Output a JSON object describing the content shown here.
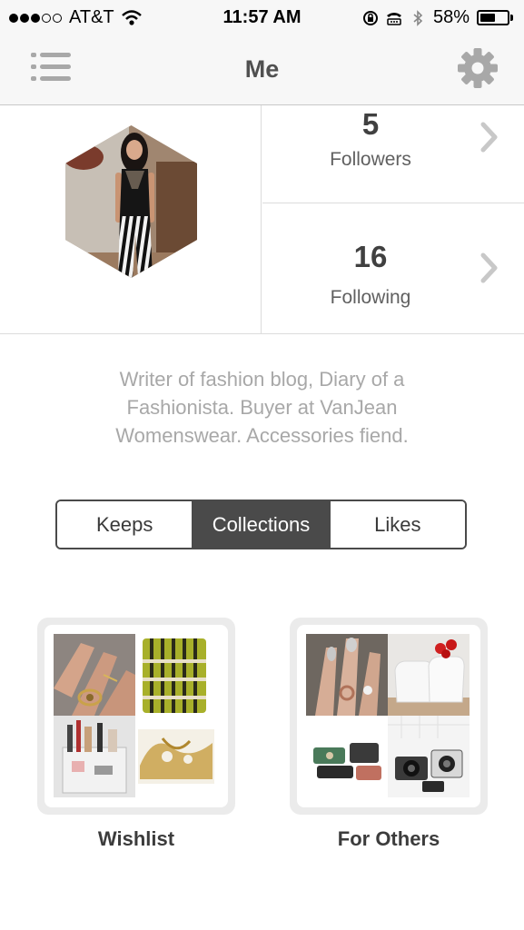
{
  "status_bar": {
    "carrier": "AT&T",
    "time": "11:57 AM",
    "battery": "58%",
    "battery_level": 0.58,
    "signal_bars": 3
  },
  "nav": {
    "title": "Me"
  },
  "profile": {
    "followers": {
      "count": "5",
      "label": "Followers"
    },
    "following": {
      "count": "16",
      "label": "Following"
    },
    "bio": "Writer of fashion blog, Diary of a Fashionista. Buyer at VanJean Womenswear. Accessories fiend."
  },
  "tabs": [
    {
      "label": "Keeps",
      "active": false
    },
    {
      "label": "Collections",
      "active": true
    },
    {
      "label": "Likes",
      "active": false
    }
  ],
  "collections": [
    {
      "title": "Wishlist"
    },
    {
      "title": "For Others"
    }
  ],
  "colors": {
    "bar_background": "#f7f7f7",
    "active_tab": "#4a4a4a",
    "bio_text": "#a8a8a8"
  }
}
